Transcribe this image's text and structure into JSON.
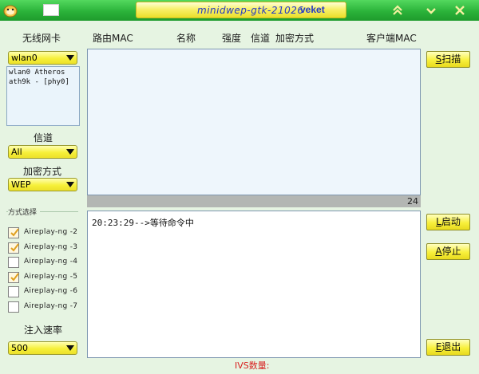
{
  "window": {
    "title": "minidwep-gtk-21026",
    "brand": "veket"
  },
  "left": {
    "nic_label": "无线网卡",
    "nic_value": "wlan0",
    "iface_lines": [
      "wlan0 Atheros",
      "ath9k - [phy0]"
    ],
    "channel_label": "信道",
    "channel_value": "All",
    "enc_label": "加密方式",
    "enc_value": "WEP",
    "mode_group": "方式选择",
    "modes": [
      {
        "label": "Aireplay-ng -2",
        "checked": true
      },
      {
        "label": "Aireplay-ng -3",
        "checked": true
      },
      {
        "label": "Aireplay-ng -4",
        "checked": false
      },
      {
        "label": "Aireplay-ng -5",
        "checked": true
      },
      {
        "label": "Aireplay-ng -6",
        "checked": false
      },
      {
        "label": "Aireplay-ng -7",
        "checked": false
      }
    ],
    "rate_label": "注入速率",
    "rate_value": "500"
  },
  "columns": [
    "路由MAC",
    "名称",
    "强度",
    "信道",
    "加密方式",
    "客户端MAC"
  ],
  "ap_count": "24",
  "log": {
    "line": "20:23:29-->等待命令中"
  },
  "ivs_label": "IVS数量:",
  "buttons": {
    "scan": {
      "key": "S",
      "label": "扫描"
    },
    "start": {
      "key": "L",
      "label": "启动"
    },
    "stop": {
      "key": "A",
      "label": "停止"
    },
    "exit": {
      "key": "E",
      "label": "退出"
    }
  },
  "colors": {
    "titlebar": "#2bb33a",
    "accent_yellow": "#f6f03a",
    "ivs_red": "#d82020"
  }
}
